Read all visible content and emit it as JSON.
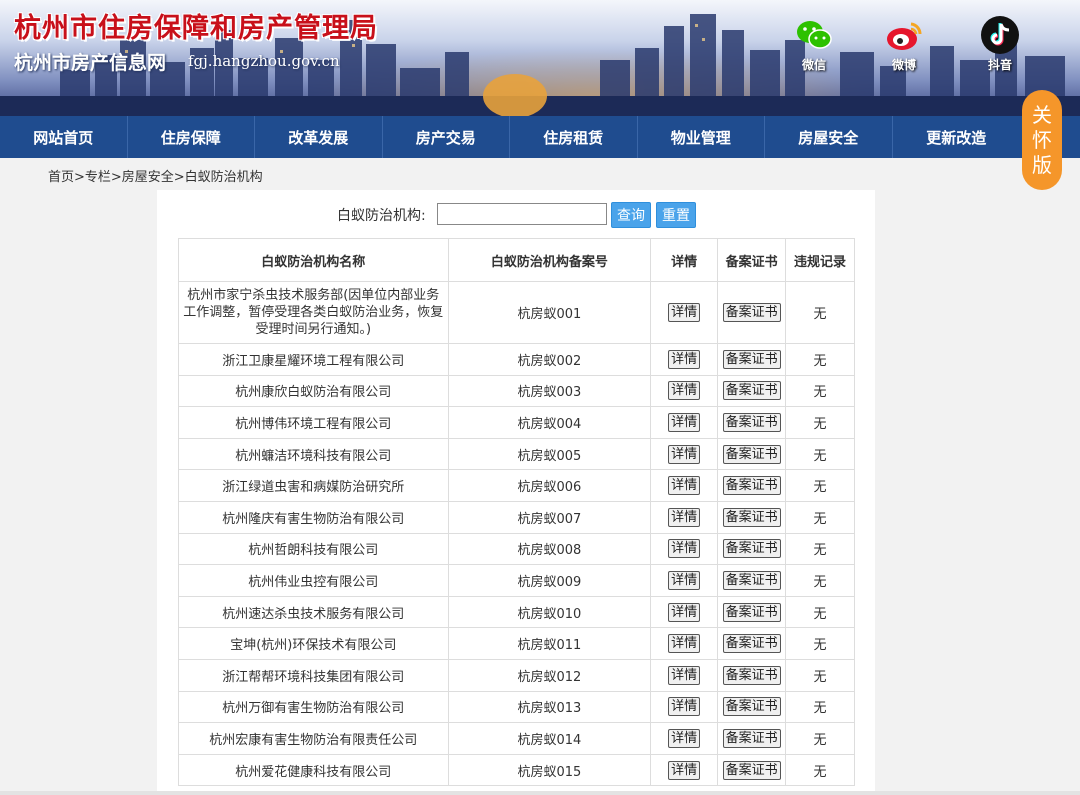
{
  "header": {
    "title": "杭州市住房保障和房产管理局",
    "subtitle": "杭州市房产信息网",
    "domain": "fgj.hangzhou.gov.cn",
    "social": [
      {
        "label": "微信",
        "icon": "wechat-icon",
        "color": "#2dc100"
      },
      {
        "label": "微博",
        "icon": "weibo-icon",
        "color": "#e6162d"
      },
      {
        "label": "抖音",
        "icon": "douyin-icon",
        "color": "#111111"
      }
    ]
  },
  "nav": {
    "items": [
      "网站首页",
      "住房保障",
      "改革发展",
      "房产交易",
      "住房租赁",
      "物业管理",
      "房屋安全",
      "更新改造"
    ]
  },
  "care_mode": {
    "chars": [
      "关",
      "怀",
      "版"
    ]
  },
  "breadcrumb": {
    "text": "首页>专栏>房屋安全>白蚁防治机构"
  },
  "search": {
    "label": "白蚁防治机构:",
    "value": "",
    "query_button": "查询",
    "reset_button": "重置"
  },
  "table": {
    "headers": [
      "白蚁防治机构名称",
      "白蚁防治机构备案号",
      "详情",
      "备案证书",
      "违规记录"
    ],
    "detail_label": "详情",
    "cert_label": "备案证书",
    "rows": [
      {
        "name": "杭州市家宁杀虫技术服务部(因单位内部业务工作调整，暂停受理各类白蚁防治业务，恢复受理时间另行通知。)",
        "code": "杭房蚁001",
        "violation": "无"
      },
      {
        "name": "浙江卫康星耀环境工程有限公司",
        "code": "杭房蚁002",
        "violation": "无"
      },
      {
        "name": "杭州康欣白蚁防治有限公司",
        "code": "杭房蚁003",
        "violation": "无"
      },
      {
        "name": "杭州博伟环境工程有限公司",
        "code": "杭房蚁004",
        "violation": "无"
      },
      {
        "name": "杭州蠊洁环境科技有限公司",
        "code": "杭房蚁005",
        "violation": "无"
      },
      {
        "name": "浙江绿道虫害和病媒防治研究所",
        "code": "杭房蚁006",
        "violation": "无"
      },
      {
        "name": "杭州隆庆有害生物防治有限公司",
        "code": "杭房蚁007",
        "violation": "无"
      },
      {
        "name": "杭州哲朗科技有限公司",
        "code": "杭房蚁008",
        "violation": "无"
      },
      {
        "name": "杭州伟业虫控有限公司",
        "code": "杭房蚁009",
        "violation": "无"
      },
      {
        "name": "杭州速达杀虫技术服务有限公司",
        "code": "杭房蚁010",
        "violation": "无"
      },
      {
        "name": "宝坤(杭州)环保技术有限公司",
        "code": "杭房蚁011",
        "violation": "无"
      },
      {
        "name": "浙江帮帮环境科技集团有限公司",
        "code": "杭房蚁012",
        "violation": "无"
      },
      {
        "name": "杭州万御有害生物防治有限公司",
        "code": "杭房蚁013",
        "violation": "无"
      },
      {
        "name": "杭州宏康有害生物防治有限责任公司",
        "code": "杭房蚁014",
        "violation": "无"
      },
      {
        "name": "杭州爱花健康科技有限公司",
        "code": "杭房蚁015",
        "violation": "无"
      }
    ]
  },
  "colors": {
    "nav_bg": "#1f4c8f",
    "accent_blue": "#4aa3ea",
    "care_orange": "#f5962a",
    "title_red": "#c8101a"
  }
}
